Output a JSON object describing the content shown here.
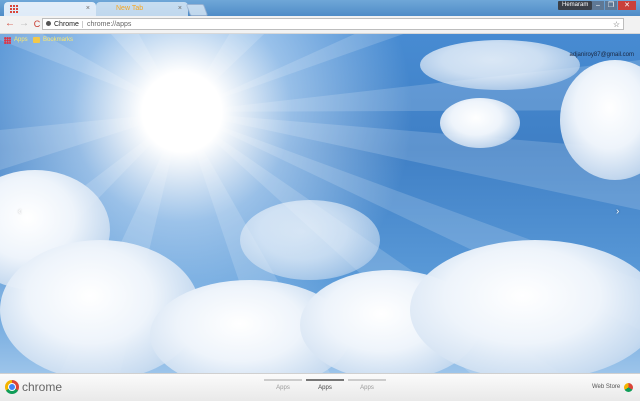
{
  "tabs": [
    {
      "label": "",
      "active": true
    },
    {
      "label": "New Tab",
      "active": false
    }
  ],
  "window": {
    "profile_name": "Hemaram",
    "minimize": "–",
    "maximize": "❐",
    "close": "✕"
  },
  "toolbar": {
    "back": "←",
    "forward": "→",
    "reload": "C",
    "omnibox_chip": "Chrome",
    "omnibox_url": "chrome://apps",
    "star": "☆"
  },
  "bookmarks": [
    {
      "label": "Apps",
      "icon": "apps-grid-icon"
    },
    {
      "label": "Bookmarks",
      "icon": "folder-icon"
    }
  ],
  "account_email": "adjaniroy87@gmail.com",
  "nav_arrows": {
    "left": "‹",
    "right": "›"
  },
  "bottombar": {
    "brand": "chrome",
    "pages": [
      {
        "label": "Apps",
        "active": false
      },
      {
        "label": "Apps",
        "active": true
      },
      {
        "label": "Apps",
        "active": false
      }
    ],
    "webstore": "Web Store"
  },
  "colors": {
    "tab_warning": "#f5a623",
    "reload": "#c83a2f",
    "bookmark_text": "#ffe96b"
  }
}
